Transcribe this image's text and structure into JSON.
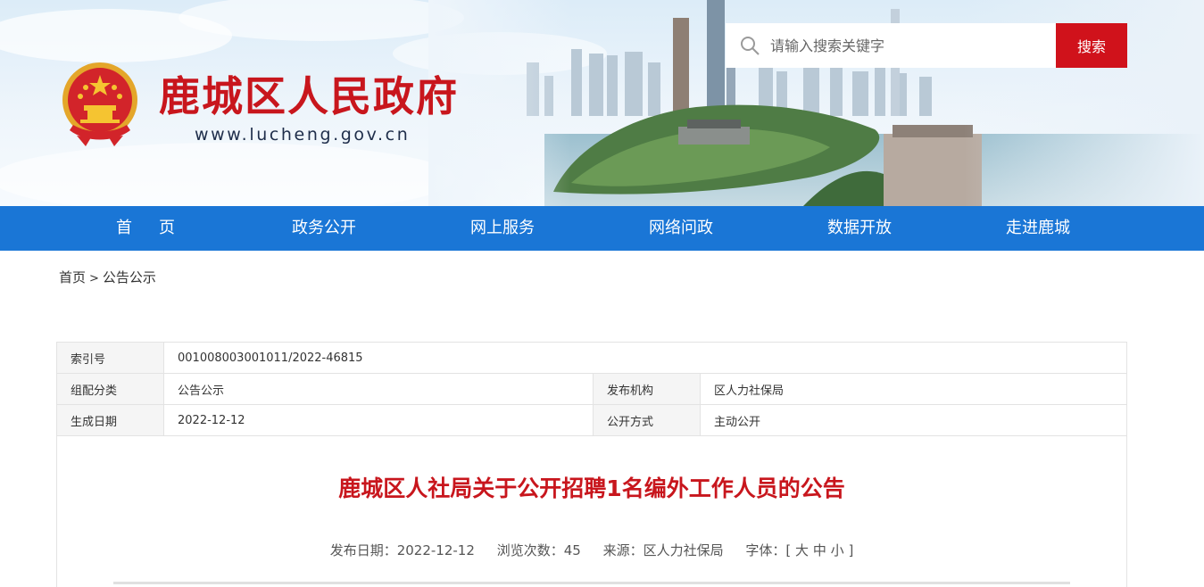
{
  "header": {
    "site_title": "鹿城区人民政府",
    "site_url": "www.lucheng.gov.cn",
    "search": {
      "placeholder": "请输入搜索关键字",
      "button_label": "搜索"
    }
  },
  "nav": {
    "items": [
      {
        "label": "首页"
      },
      {
        "label": "政务公开"
      },
      {
        "label": "网上服务"
      },
      {
        "label": "网络问政"
      },
      {
        "label": "数据开放"
      },
      {
        "label": "走进鹿城"
      }
    ]
  },
  "breadcrumb": {
    "home": "首页",
    "separator": ">",
    "current": "公告公示"
  },
  "meta": {
    "index_label": "索引号",
    "index_value": "001008003001011/2022-46815",
    "category_label": "组配分类",
    "category_value": "公告公示",
    "publisher_label": "发布机构",
    "publisher_value": "区人力社保局",
    "date_label": "生成日期",
    "date_value": "2022-12-12",
    "method_label": "公开方式",
    "method_value": "主动公开"
  },
  "article": {
    "title": "鹿城区人社局关于公开招聘1名编外工作人员的公告",
    "publish_label": "发布日期：",
    "publish_date": "2022-12-12",
    "views_label": "浏览次数：",
    "views": "45",
    "source_label": "来源：",
    "source": "区人力社保局",
    "font_label": "字体：",
    "font_open": "[",
    "font_large": "大",
    "font_medium": "中",
    "font_small": "小",
    "font_close": "]"
  },
  "colors": {
    "brand_red": "#c8161d",
    "nav_blue": "#1a76d6",
    "search_red": "#d0121b"
  },
  "icons": [
    "national-emblem-icon",
    "search-icon"
  ]
}
